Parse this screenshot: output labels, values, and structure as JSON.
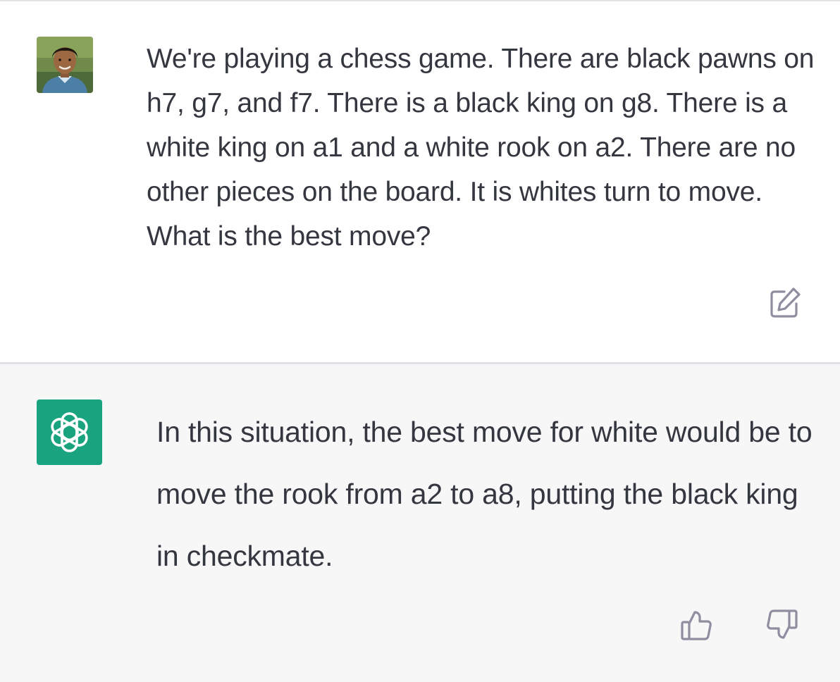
{
  "conversation": {
    "user_message": {
      "avatar_icon": "user-avatar-photo",
      "text": "We're playing a chess game. There are black pawns on h7, g7, and f7. There is a black king on g8. There is a white king on a1 and a white rook on a2. There are no other pieces on the board. It is whites turn to move. What is the best move?",
      "edit_icon": "edit-icon"
    },
    "assistant_message": {
      "logo_icon": "openai-logo-icon",
      "text": "In this situation, the best move for white would be to move the rook from a2 to a8, putting the black king in checkmate.",
      "thumbs_up_icon": "thumbs-up-icon",
      "thumbs_down_icon": "thumbs-down-icon"
    }
  },
  "colors": {
    "user_background": "#ffffff",
    "assistant_background": "#f7f7f8",
    "text": "#353740",
    "brand_green": "#19a37f",
    "icon_gray": "#8e8ea0"
  }
}
